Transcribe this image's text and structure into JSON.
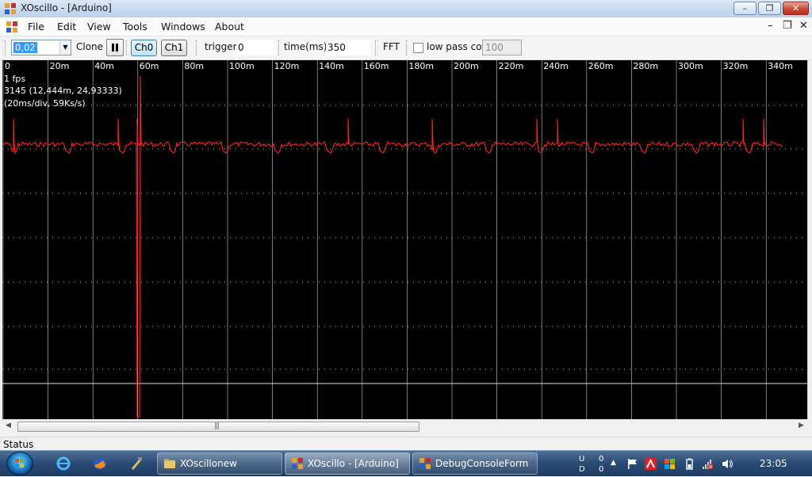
{
  "window": {
    "title": "XOscillo - [Arduino]",
    "minimize": "–",
    "maximize": "❐",
    "close": "✕"
  },
  "menu": [
    "File",
    "Edit",
    "View",
    "Tools",
    "Windows",
    "About"
  ],
  "mdi": {
    "minimize": "–",
    "restore": "❐",
    "close": "✕"
  },
  "toolbar": {
    "scale_value": "0,02",
    "clone_label": "Clone",
    "ch0_label": "Ch0",
    "ch1_label": "Ch1",
    "trigger_label": "trigger",
    "trigger_value": "0",
    "time_label": "time(ms)",
    "time_value": "350",
    "fft_label": "FFT",
    "lowpass_label": "low pass cof",
    "lowpass_value": "100",
    "lowpass_checked": false
  },
  "scope": {
    "info": [
      "1 fps",
      "3145 (12,444m, 24,93333)",
      "(20ms/div, 59Ks/s)"
    ],
    "time_ticks": [
      "0",
      "20m",
      "40m",
      "60m",
      "80m",
      "100m",
      "120m",
      "140m",
      "160m",
      "180m",
      "200m",
      "220m",
      "240m",
      "260m",
      "280m",
      "300m",
      "320m",
      "340m"
    ],
    "background": "#000000",
    "trace_color": "#ff2020",
    "grid_color": "#ffffff"
  },
  "status": {
    "text": "Status"
  },
  "taskbar": {
    "tasks": [
      "XOscillonew",
      "XOscillo - [Arduino]",
      "DebugConsoleForm"
    ],
    "net_up": "U",
    "net_down": "D",
    "net_up_value": "0",
    "net_down_value": "0",
    "clock": "23:05"
  }
}
